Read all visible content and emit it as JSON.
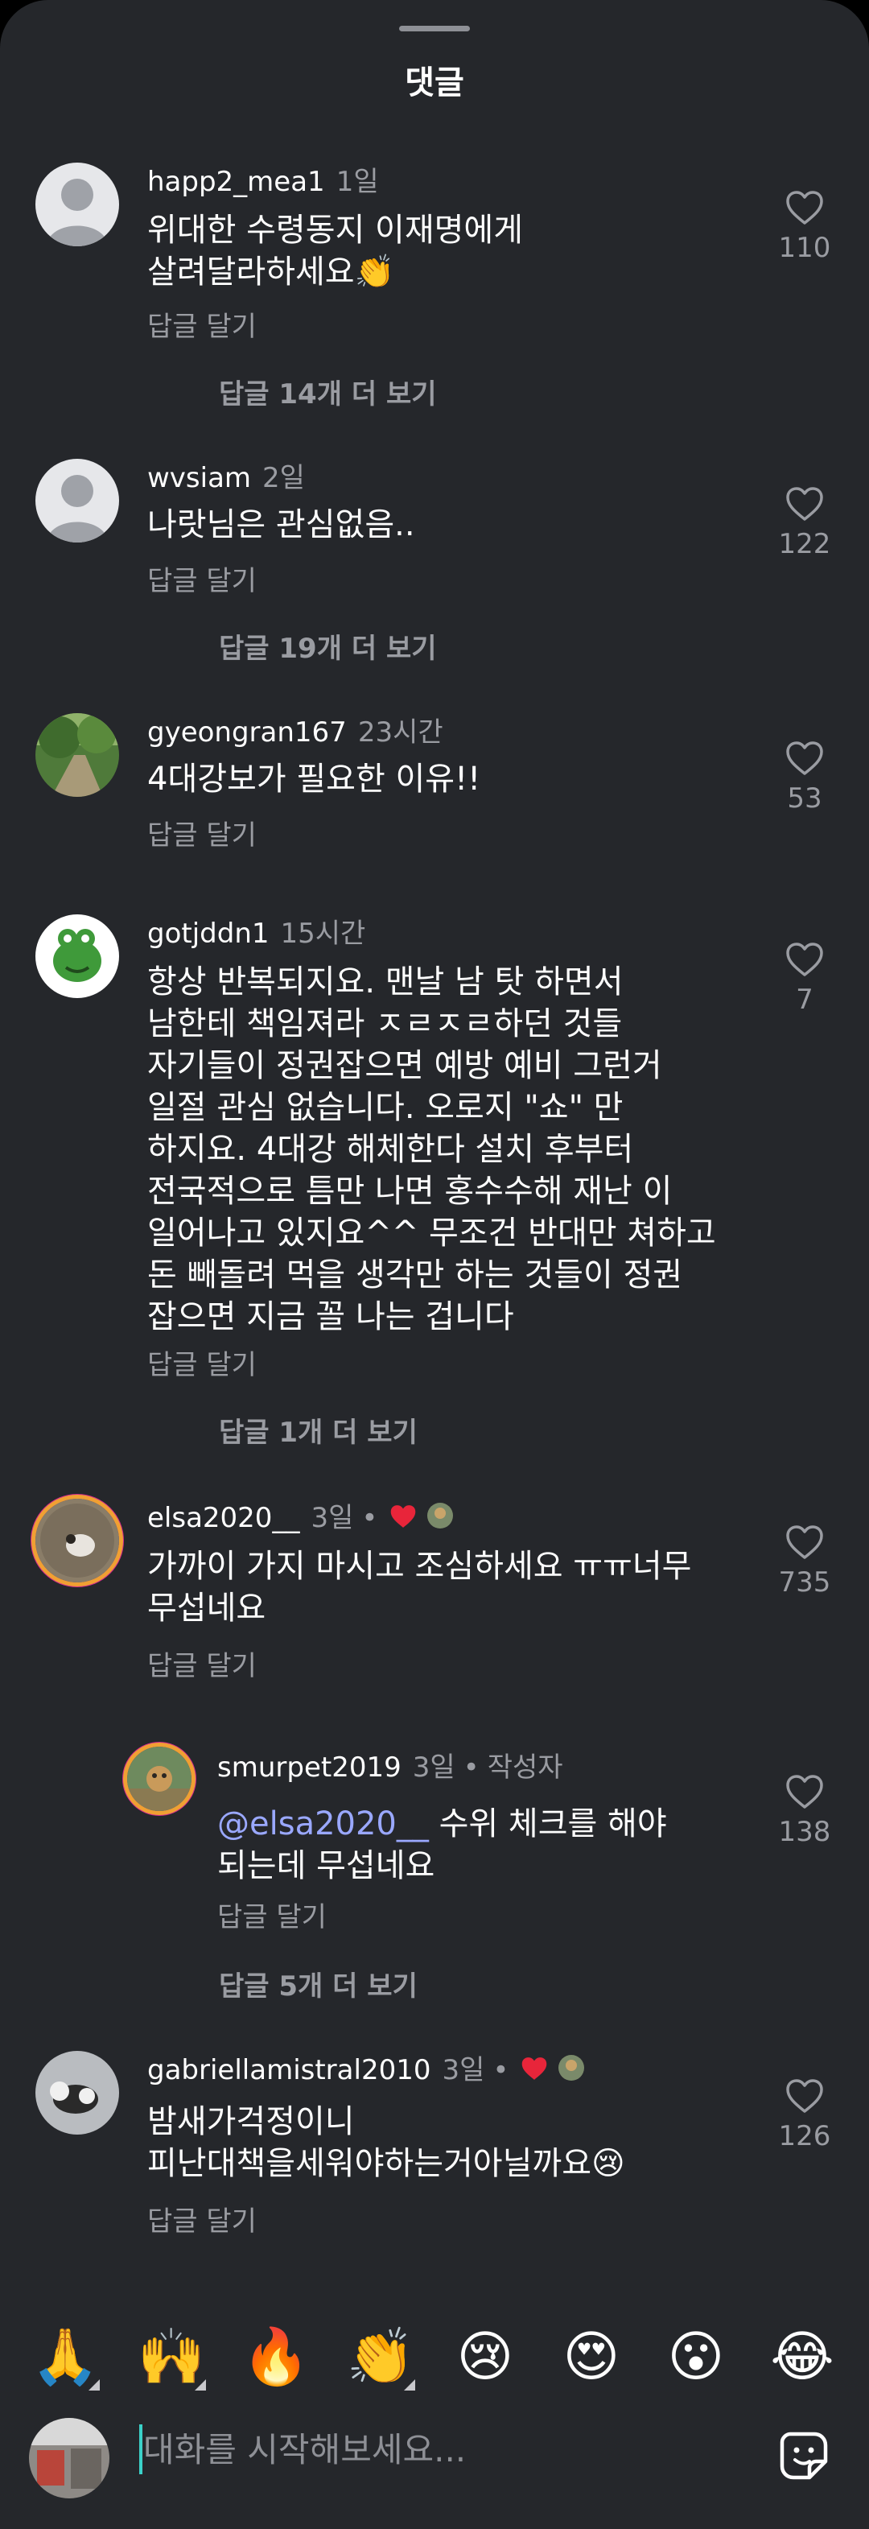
{
  "header": {
    "title": "댓글"
  },
  "comments": [
    {
      "user": "happ2_mea1",
      "time": "1일",
      "text": "위대한 수령동지 이재명에게\n살려달라하세요👏",
      "reply": "답글 달기",
      "likes": "110",
      "more": "답글 14개 더 보기"
    },
    {
      "user": "wvsiam",
      "time": "2일",
      "text": "나랏님은 관심없음..",
      "reply": "답글 달기",
      "likes": "122",
      "more": "답글 19개 더 보기"
    },
    {
      "user": "gyeongran167",
      "time": "23시간",
      "text": "4대강보가 필요한 이유!!",
      "reply": "답글 달기",
      "likes": "53"
    },
    {
      "user": "gotjddn1",
      "time": "15시간",
      "text": "항상 반복되지요. 맨날 남 탓 하면서\n남한테 책임져라 ㅈㄹㅈㄹ하던 것들\n자기들이 정권잡으면 예방 예비 그런거\n일절 관심 없습니다. 오로지 \"쇼\" 만\n하지요. 4대강 해체한다 설치 후부터\n전국적으로 틈만 나면 홍수수해 재난 이\n일어나고 있지요^^ 무조건 반대만 쳐하고\n돈 빼돌려 먹을 생각만 하는 것들이 정권\n잡으면 지금 꼴 나는 겁니다",
      "reply": "답글 달기",
      "likes": "7",
      "more": "답글 1개 더 보기"
    },
    {
      "user": "elsa2020__",
      "time": "3일",
      "dot": "•",
      "text": "가까이 가지 마시고 조심하세요 ㅠㅠ너무\n무섭네요",
      "reply": "답글 달기",
      "likes": "735"
    },
    {
      "user": "smurpet2019",
      "time": "3일",
      "dot": "•",
      "author": "작성자",
      "mention": "@elsa2020__",
      "text": " 수위 체크를 해야\n되는데 무섭네요",
      "reply": "답글 달기",
      "likes": "138",
      "more": "답글 5개 더 보기"
    },
    {
      "user": "gabriellamistral2010",
      "time": "3일",
      "dot": "•",
      "text": "밤새가걱정이니\n피난대책을세워야하는거아닐까요😢",
      "reply": "답글 달기",
      "likes": "126"
    }
  ],
  "emojis": [
    "🙏",
    "🙌",
    "🔥",
    "👏",
    "😢",
    "😍",
    "😮",
    "😂"
  ],
  "composer": {
    "placeholder": "대화를 시작해보세요..."
  },
  "colors": {
    "background": "#25272b",
    "muted": "#9a9ca2",
    "mention": "#9aa8ff",
    "like_red": "#e8253a",
    "caret": "#3bd1c9"
  }
}
